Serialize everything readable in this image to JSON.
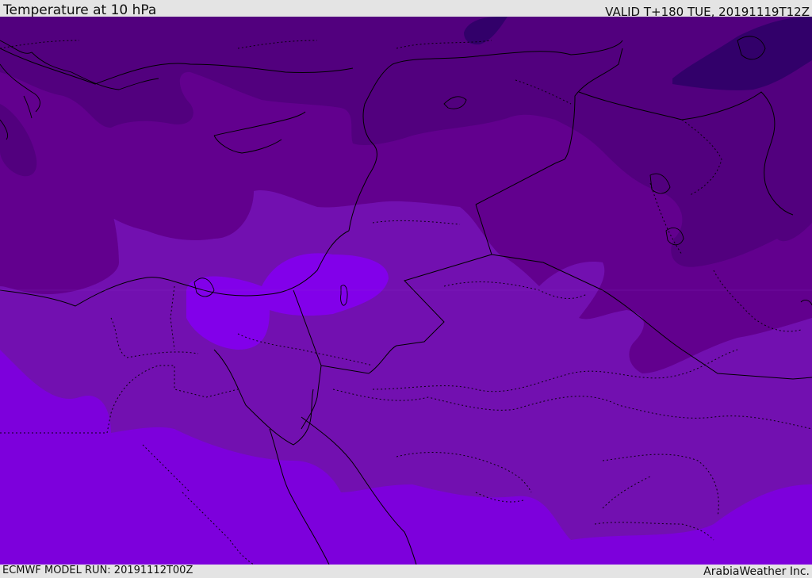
{
  "header": {
    "title": "Temperature at 10 hPa",
    "valid_time": "VALID T+180 TUE, 20191119T12Z"
  },
  "footer": {
    "model_run": "ECMWF MODEL RUN: 20191112T00Z",
    "credit": "ArabiaWeather Inc."
  },
  "map": {
    "variable": "temperature",
    "level": "10 hPa",
    "colors": {
      "band_darkest": "#32006a",
      "band_dark": "#52007e",
      "band_mid_dark": "#62008e",
      "band_mid": "#7210b0",
      "band_light": "#7d00dc",
      "band_lightest_patch": "#8200ea",
      "border_line": "#000000"
    }
  }
}
